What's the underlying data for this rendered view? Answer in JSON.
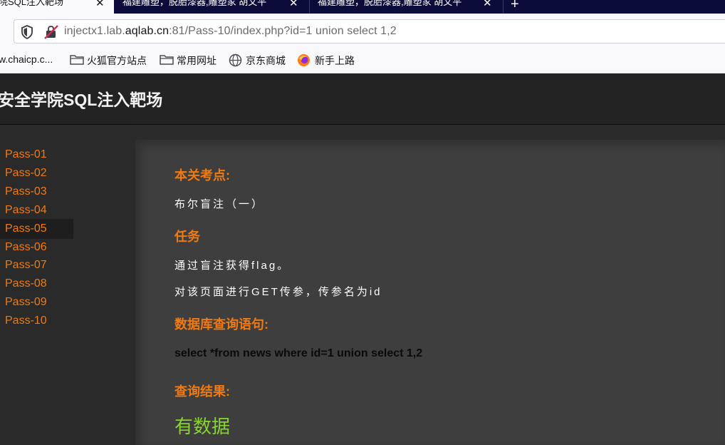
{
  "browser": {
    "tabs": [
      {
        "label": "院SQL注入靶场",
        "active": true
      },
      {
        "label": "福建雕塑，脱胎漆器,雕塑家 胡文平",
        "active": false
      },
      {
        "label": "福建雕塑，脱胎漆器,雕塑家 胡文平",
        "active": false
      }
    ],
    "close_glyph": "✕",
    "new_tab_glyph": "+",
    "url": {
      "prefix": "injectx1.lab.",
      "domain": "aqlab.cn",
      "suffix": ":81/Pass-10/index.php?id=1 union select 1,2"
    },
    "bookmarks": [
      {
        "label": "w.chaicp.c...",
        "icon": "none"
      },
      {
        "label": "火狐官方站点",
        "icon": "folder-icon"
      },
      {
        "label": "常用网址",
        "icon": "folder-icon"
      },
      {
        "label": "京东商城",
        "icon": "globe-icon"
      },
      {
        "label": "新手上路",
        "icon": "firefox-icon"
      }
    ]
  },
  "site": {
    "title": "安全学院SQL注入靶场"
  },
  "sidebar": {
    "items": [
      "Pass-01",
      "Pass-02",
      "Pass-03",
      "Pass-04",
      "Pass-05",
      "Pass-06",
      "Pass-07",
      "Pass-08",
      "Pass-09",
      "Pass-10"
    ]
  },
  "content": {
    "section1_title": "本关考点:",
    "section1_text": "布尔盲注（一）",
    "section2_title": "任务",
    "task_line1": "通过盲注获得flag。",
    "task_line2": "对该页面进行GET传参，传参名为id",
    "section3_title": "数据库查询语句:",
    "sql": "select *from news where id=1 union select 1,2",
    "section4_title": "查询结果:",
    "result": "有数据"
  },
  "colors": {
    "accent": "#f07a10",
    "result": "#88d42f",
    "tabstrip": "#0c0c3a"
  }
}
